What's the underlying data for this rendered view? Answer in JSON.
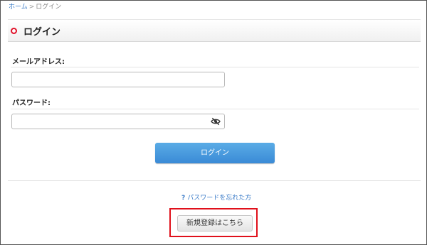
{
  "breadcrumb": {
    "home_label": "ホーム",
    "separator": ">",
    "current_label": "ログイン"
  },
  "header": {
    "title": "ログイン"
  },
  "form": {
    "email_label": "メールアドレス:",
    "email_value": "",
    "password_label": "パスワード:",
    "password_value": "",
    "login_button_label": "ログイン"
  },
  "links": {
    "forgot_password_label": "パスワードを忘れた方"
  },
  "register": {
    "button_label": "新規登録はこちら"
  },
  "colors": {
    "accent_blue": "#3a8ad6",
    "title_marker_red": "#e0122a",
    "highlight_red": "#e0101b"
  },
  "icons": {
    "password_toggle": "eye-slash-icon",
    "forgot_marker": "question-icon",
    "title_marker": "circle-marker-icon"
  }
}
